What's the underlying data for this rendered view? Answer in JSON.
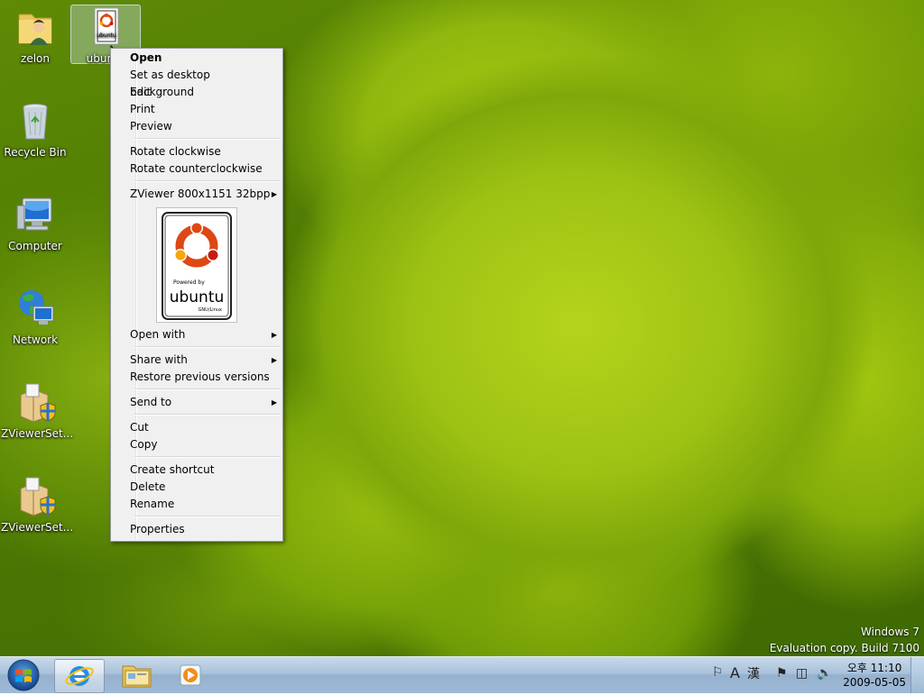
{
  "desktop": {
    "icons": [
      {
        "label": "zelon"
      },
      {
        "label": "ubuntu"
      },
      {
        "label": "Recycle Bin"
      },
      {
        "label": "Computer"
      },
      {
        "label": "Network"
      },
      {
        "label": "ZViewerSet..."
      },
      {
        "label": "ZViewerSet..."
      }
    ],
    "watermark": {
      "line1": "Windows 7",
      "line2": "Evaluation copy. Build 7100"
    }
  },
  "context_menu": {
    "open": "Open",
    "set_background": "Set as desktop background",
    "edit": "Edit",
    "print": "Print",
    "preview": "Preview",
    "rotate_cw": "Rotate clockwise",
    "rotate_ccw": "Rotate counterclockwise",
    "zviewer": "ZViewer 800x1151 32bpp",
    "preview_image": {
      "caption": "Powered by",
      "brand": "ubuntu",
      "sub": "GNU/Linux"
    },
    "open_with": "Open with",
    "share_with": "Share with",
    "restore": "Restore previous versions",
    "send_to": "Send to",
    "cut": "Cut",
    "copy": "Copy",
    "create_shortcut": "Create shortcut",
    "delete": "Delete",
    "rename": "Rename",
    "properties": "Properties"
  },
  "taskbar": {
    "clock_time": "오후 11:10",
    "clock_date": "2009-05-05",
    "ime_mode": "A",
    "ime_hanja": "漢"
  },
  "colors": {
    "accent": "#1e73be",
    "ubuntu_orange": "#dd4814",
    "taskbar": "#a9c1da"
  }
}
